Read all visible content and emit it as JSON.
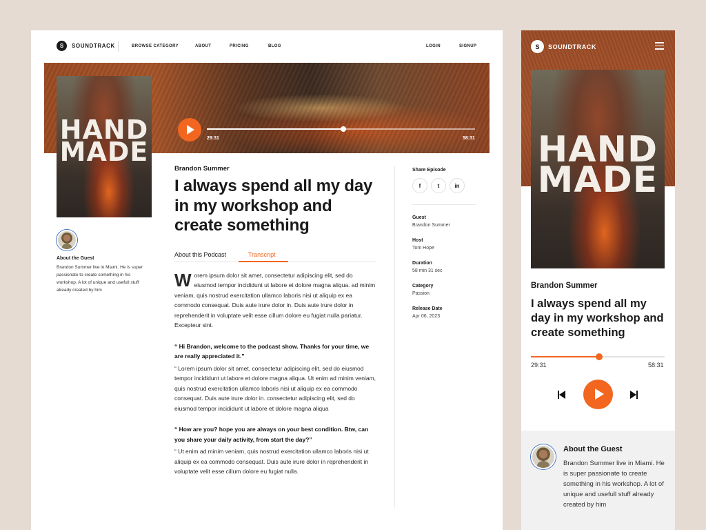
{
  "brand": {
    "name": "SOUNDTRACK",
    "mark": "S"
  },
  "nav": {
    "browse": "BROWSE CATEGORY",
    "about": "ABOUT",
    "pricing": "PRICING",
    "blog": "BLOG",
    "login": "LOGIN",
    "signup": "SIGNUP"
  },
  "cover": {
    "line1": "HAND",
    "line2": "MADE"
  },
  "player": {
    "current_time": "29:31",
    "total_time": "58:31",
    "progress": 0.51
  },
  "guest_sidebar": {
    "heading": "About the Guest",
    "bio": "Brandon Summer live in Miami. He is super passionate to create something in his workshop. A lot of unique and usefull stuff already created by him"
  },
  "episode": {
    "author": "Brandon Summer",
    "title": "I always spend all my day in my workshop and create something"
  },
  "tabs": {
    "about": "About this Podcast",
    "transcript": "Transcript"
  },
  "transcript": {
    "dropcap": "W",
    "intro": "orem ipsum dolor sit amet, consectetur adipiscing elit, sed do eiusmod tempor incididunt ut labore et dolore magna aliqua. ad minim veniam, quis nostrud exercitation ullamco laboris nisi ut aliquip ex ea commodo consequat. Duis aute irure dolor in. Duis aute irure dolor in reprehenderit in voluptate velit esse cillum dolore eu fugiat nulla pariatur. Excepteur sint.",
    "q1": "“ Hi Brandon, welcome to the podcast show. Thanks for your time, we are really appreciated it.”",
    "a1": "“ Lorem ipsum dolor sit amet, consectetur adipiscing elit, sed do eiusmod tempor incididunt ut labore et dolore magna aliqua. Ut enim ad minim veniam, quis nostrud exercitation ullamco laboris nisi ut aliquip ex ea commodo consequat. Duis aute irure dolor in. consectetur adipiscing elit, sed do eiusmod tempor incididunt ut labore et dolore magna aliqua",
    "q2": "“ How are you? hope you are always on your best condition. Btw, can you share your daily activity, from start the day?”",
    "a2": "“ Ut enim ad minim veniam, quis nostrud exercitation ullamco laboris nisi ut aliquip ex ea commodo consequat. Duis aute irure dolor in reprehenderit in voluptate velit esse cillum dolore eu fugiat nulla."
  },
  "share": {
    "heading": "Share Episode",
    "icons": [
      "facebook-icon",
      "twitter-icon",
      "linkedin-icon"
    ],
    "facebook": "f",
    "twitter": "t",
    "linkedin": "in"
  },
  "meta": {
    "guest_label": "Guest",
    "guest": "Brandon Summer",
    "host_label": "Host",
    "host": "Tom Hope",
    "duration_label": "Duration",
    "duration": "58 min 31 sec",
    "category_label": "Category",
    "category": "Passion",
    "release_label": "Release Date",
    "release": "Apr 06, 2023"
  },
  "mobile": {
    "guest_heading": "About the Guest",
    "guest_bio": "Brandon Summer live in Miami. He is super passionate to create something in his workshop. A lot of unique and usefull stuff already created by him"
  },
  "colors": {
    "accent": "#f2661f",
    "background": "#e5dbd2",
    "hero": "#a35029"
  }
}
